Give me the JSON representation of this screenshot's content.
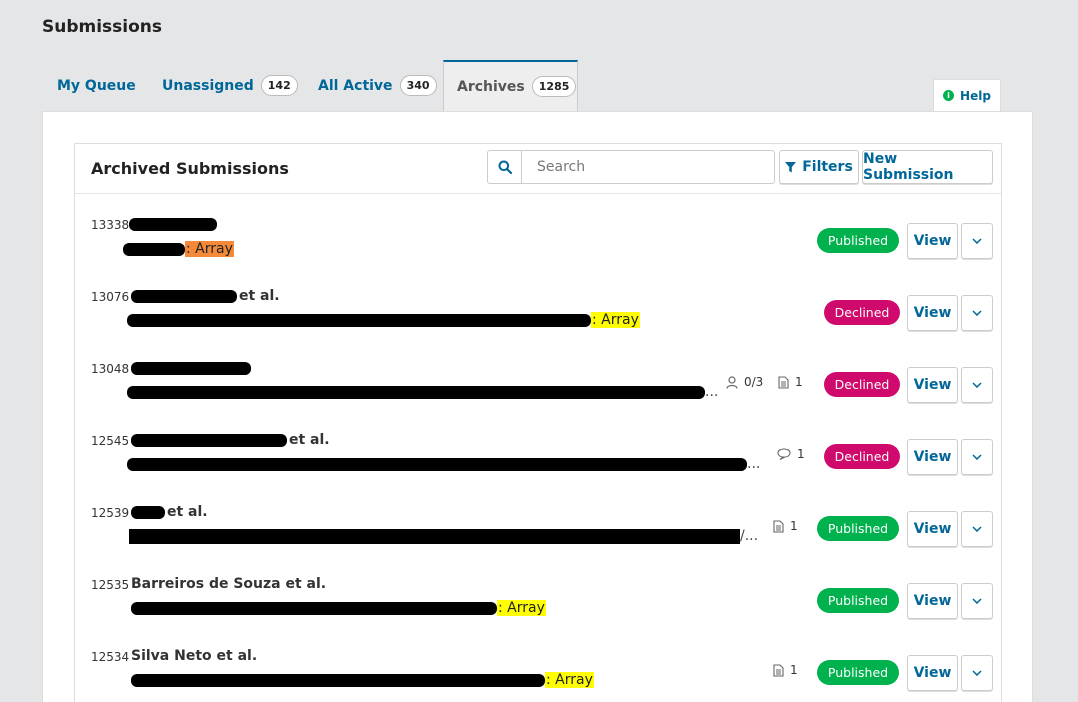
{
  "page": {
    "title": "Submissions"
  },
  "tabs": [
    {
      "label": "My Queue",
      "count": ""
    },
    {
      "label": "Unassigned",
      "count": "142"
    },
    {
      "label": "All Active",
      "count": "340"
    },
    {
      "label": "Archives",
      "count": "1285"
    }
  ],
  "help": {
    "label": "Help",
    "icon": "info-icon"
  },
  "list": {
    "title": "Archived Submissions",
    "search_placeholder": "Search",
    "filters_label": "Filters",
    "new_submission_label": "New Submission",
    "view_label": "View"
  },
  "colors": {
    "accent": "#006798",
    "published": "#00b24e",
    "declined": "#d00a6c",
    "highlight_yellow": "#ffff00",
    "highlight_orange": "#f5893a"
  },
  "submissions": [
    {
      "id": "13338",
      "author": "",
      "title_tail": ": Array",
      "status": "Published",
      "reviews": "",
      "files": "",
      "comments": ""
    },
    {
      "id": "13076",
      "author": "et al.",
      "title_tail": ": Array",
      "status": "Declined",
      "reviews": "",
      "files": "",
      "comments": ""
    },
    {
      "id": "13048",
      "author": "",
      "title_tail": "...",
      "status": "Declined",
      "reviews": "0/3",
      "files": "1",
      "comments": ""
    },
    {
      "id": "12545",
      "author": "et al.",
      "title_tail": "...",
      "status": "Declined",
      "reviews": "",
      "files": "",
      "comments": "1"
    },
    {
      "id": "12539",
      "author": "et al.",
      "title_tail": "/...",
      "status": "Published",
      "reviews": "",
      "files": "1",
      "comments": ""
    },
    {
      "id": "12535",
      "author": "Barreiros de Souza et al.",
      "title_tail": ": Array",
      "status": "Published",
      "reviews": "",
      "files": "",
      "comments": ""
    },
    {
      "id": "12534",
      "author": "Silva Neto et al.",
      "title_tail": ": Array",
      "status": "Published",
      "reviews": "",
      "files": "1",
      "comments": ""
    }
  ]
}
